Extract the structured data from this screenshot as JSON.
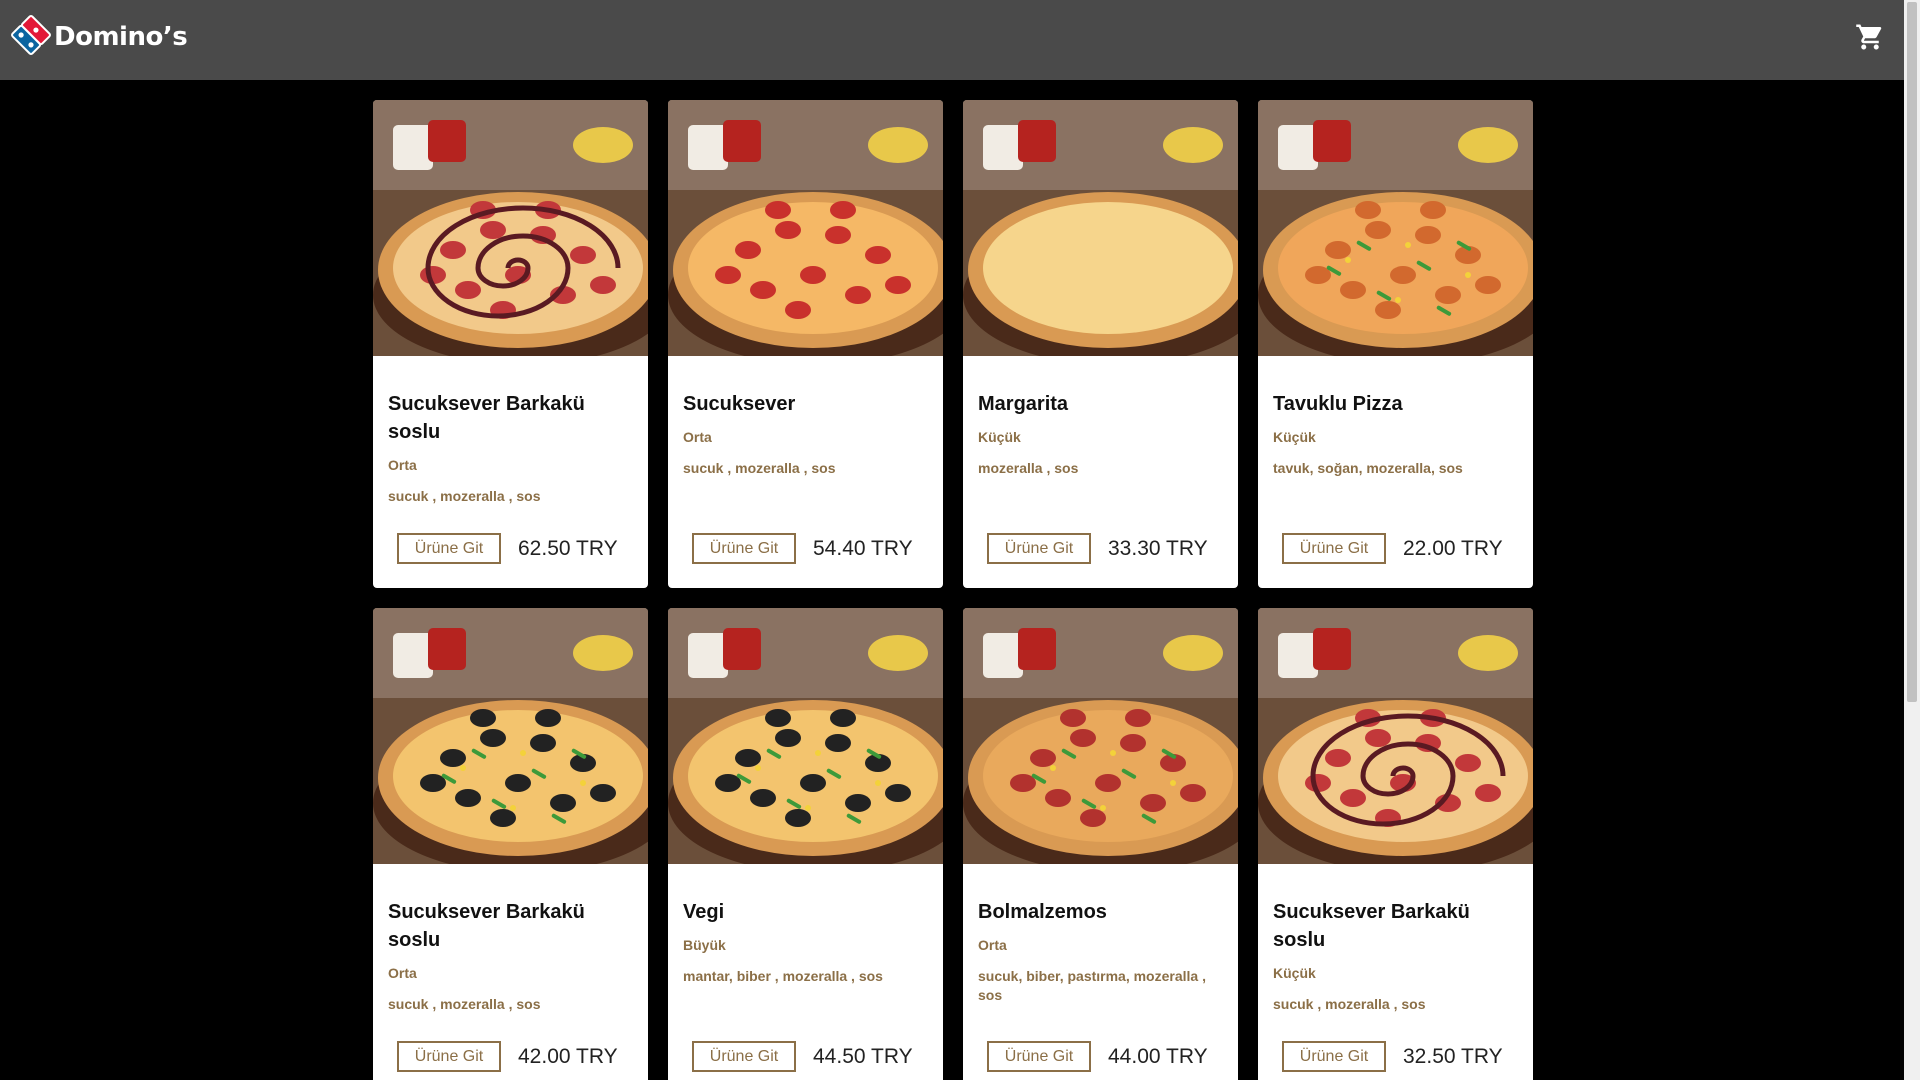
{
  "brand": {
    "name": "Domino’s"
  },
  "header": {
    "cart_icon": "shopping-cart-icon"
  },
  "colors": {
    "header_bg": "#4a4a4a",
    "page_bg": "#000000",
    "accent_brown": "#8b6f47",
    "brand_blue": "#0b64a0",
    "brand_red": "#e31837"
  },
  "products": [
    {
      "name": "Sucuksever Barkakü soslu",
      "size": "Orta",
      "ingredients": "sucuk , mozeralla , sos",
      "button": "Ürüne Git",
      "price": "62.50 TRY",
      "image": "bbq-spiral-pizza"
    },
    {
      "name": "Sucuksever",
      "size": "Orta",
      "ingredients": "sucuk , mozeralla , sos",
      "button": "Ürüne Git",
      "price": "54.40 TRY",
      "image": "pepperoni-pizza"
    },
    {
      "name": "Margarita",
      "size": "Küçük",
      "ingredients": "mozeralla , sos",
      "button": "Ürüne Git",
      "price": "33.30 TRY",
      "image": "margarita-pizza"
    },
    {
      "name": "Tavuklu Pizza",
      "size": "Küçük",
      "ingredients": "tavuk, soğan, mozeralla, sos",
      "button": "Ürüne Git",
      "price": "22.00 TRY",
      "image": "chicken-pizza"
    },
    {
      "name": "Sucuksever Barkakü soslu",
      "size": "Orta",
      "ingredients": "sucuk , mozeralla , sos",
      "button": "Ürüne Git",
      "price": "42.00 TRY",
      "image": "veggie-pizza"
    },
    {
      "name": "Vegi",
      "size": "Büyük",
      "ingredients": "mantar, biber , mozeralla , sos",
      "button": "Ürüne Git",
      "price": "44.50 TRY",
      "image": "veggie-pizza"
    },
    {
      "name": "Bolmalzemos",
      "size": "Orta",
      "ingredients": "sucuk, biber, pastırma, mozeralla , sos",
      "button": "Ürüne Git",
      "price": "44.00 TRY",
      "image": "supreme-pizza"
    },
    {
      "name": "Sucuksever Barkakü soslu",
      "size": "Küçük",
      "ingredients": "sucuk , mozeralla , sos",
      "button": "Ürüne Git",
      "price": "32.50 TRY",
      "image": "bbq-spiral-pizza"
    }
  ]
}
